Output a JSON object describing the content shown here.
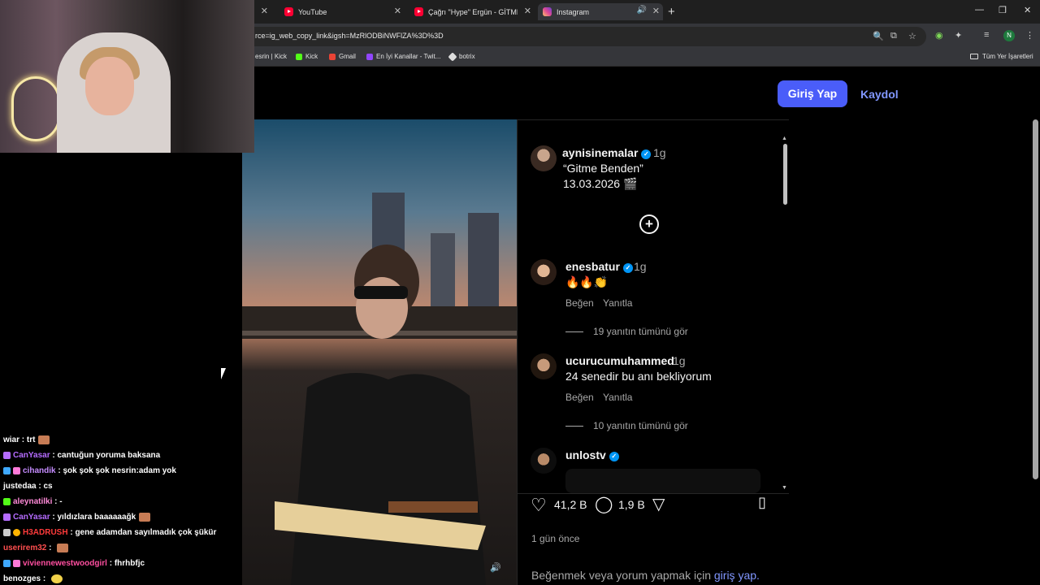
{
  "browser": {
    "tabs": [
      {
        "title": "YouTube",
        "icon": "youtube-icon",
        "active": false
      },
      {
        "title": "Çağrı \"Hype\" Ergün - GİTME BE",
        "icon": "youtube-icon",
        "active": false
      },
      {
        "title": "Instagram",
        "icon": "instagram-icon",
        "active": true
      }
    ],
    "url": "rce=ig_web_copy_link&igsh=MzRlODBiNWFlZA%3D%3D",
    "profile_initial": "N",
    "bookmarks": [
      "esrin | Kick",
      "Kick",
      "Gmail",
      "En İyi Kanallar - Twit...",
      "botrix"
    ],
    "all_bookmarks": "Tüm Yer İşaretleri"
  },
  "instagram": {
    "login_button": "Giriş Yap",
    "signup_link": "Kaydol",
    "caption": {
      "username": "aynisinemalar",
      "time": "1g",
      "line1": "“Gitme Benden”",
      "line2": "13.03.2026 🎬"
    },
    "comments": [
      {
        "username": "enesbatur",
        "verified": true,
        "time": "1g",
        "text": "🔥🔥👏",
        "like": "Beğen",
        "reply": "Yanıtla",
        "replies": "19 yanıtın tümünü gör"
      },
      {
        "username": "ucurucumuhammed",
        "verified": false,
        "time": "1g",
        "text": "24 senedir bu anı bekliyorum",
        "like": "Beğen",
        "reply": "Yanıtla",
        "replies": "10 yanıtın tümünü gör"
      },
      {
        "username": "unlostv",
        "verified": true
      }
    ],
    "likes": "41,2 B",
    "comment_count": "1,9 B",
    "posted": "1 gün önce",
    "login_hint": "Beğenmek veya yorum yapmak için",
    "login_hint_link": "giriş yap."
  },
  "chat": [
    {
      "user": "wiar",
      "color": "#ffffff",
      "msg": "trt"
    },
    {
      "user": "CanYasar",
      "color": "#b56cff",
      "msg": "cantuğun yoruma baksana"
    },
    {
      "user": "cihandik",
      "color": "#c58cff",
      "msg": "şok şok şok nesrin:adam yok"
    },
    {
      "user": "justedaa",
      "color": "#ffffff",
      "msg": "cs"
    },
    {
      "user": "aleynatilki",
      "color": "#ff8ad8",
      "msg": "-"
    },
    {
      "user": "CanYasar",
      "color": "#b56cff",
      "msg": "yıldızlara baaaaaağk"
    },
    {
      "user": "H3ADRUSH",
      "color": "#ff3b3b",
      "msg": "gene adamdan sayılmadık çok şükür"
    },
    {
      "user": "userirem32",
      "color": "#ff4f4f",
      "msg": ""
    },
    {
      "user": "viviennewestwoodgirl",
      "color": "#ff4fa0",
      "msg": "fhrhbfjc"
    },
    {
      "user": "benozges",
      "color": "#ffffff",
      "msg": ""
    }
  ]
}
